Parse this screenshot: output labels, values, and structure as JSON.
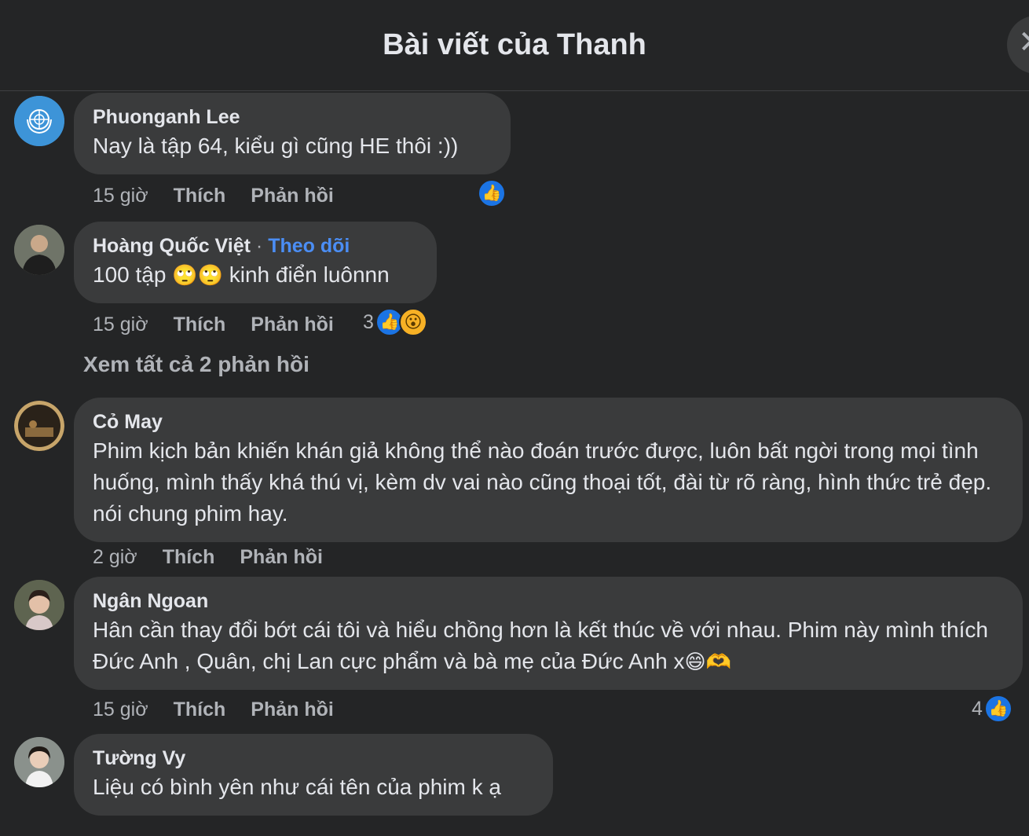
{
  "header": {
    "title": "Bài viết của Thanh",
    "close_icon": "close-icon"
  },
  "comments": [
    {
      "author": "Phuonganh Lee",
      "text": "Nay là tập 64, kiểu gì cũng HE thôi :))",
      "time": "15 giờ",
      "like_label": "Thích",
      "reply_label": "Phản hồi",
      "reaction_count": "",
      "avatar_color": "#3d94d8"
    },
    {
      "author": "Hoàng Quốc Việt",
      "follow_sep": "·",
      "follow_label": "Theo dõi",
      "text_before": "100 tập",
      "emoji": "🙄🙄",
      "text_after": "kinh điển luônnn",
      "time": "15 giờ",
      "like_label": "Thích",
      "reply_label": "Phản hồi",
      "reaction_count": "3"
    },
    {
      "author": "Cỏ May",
      "text": "Phim kịch bản khiến khán giả không thể nào đoán trước được, luôn bất ngời trong mọi tình huống, mình thấy khá thú vị, kèm dv vai nào cũng thoại tốt, đài từ rõ ràng, hình thức trẻ đẹp. nói chung phim hay.",
      "time": "2 giờ",
      "like_label": "Thích",
      "reply_label": "Phản hồi"
    },
    {
      "author": "Ngân Ngoan",
      "text": "Hân cần thay đổi bớt cái tôi và hiểu chồng hơn là kết thúc về với nhau. Phim này mình thích Đức Anh , Quân, chị Lan cực phẩm và bà mẹ của Đức Anh x",
      "emoji": "😄🫶",
      "time": "15 giờ",
      "like_label": "Thích",
      "reply_label": "Phản hồi",
      "reaction_count": "4"
    },
    {
      "author": "Tường Vy",
      "text": "Liệu có bình yên như cái tên của phim k ạ"
    }
  ],
  "view_replies": "Xem tất cả 2 phản hồi",
  "colors": {
    "background": "#242526",
    "bubble": "#3a3b3c",
    "accent": "#4b8ef5",
    "like": "#1b74e4"
  }
}
